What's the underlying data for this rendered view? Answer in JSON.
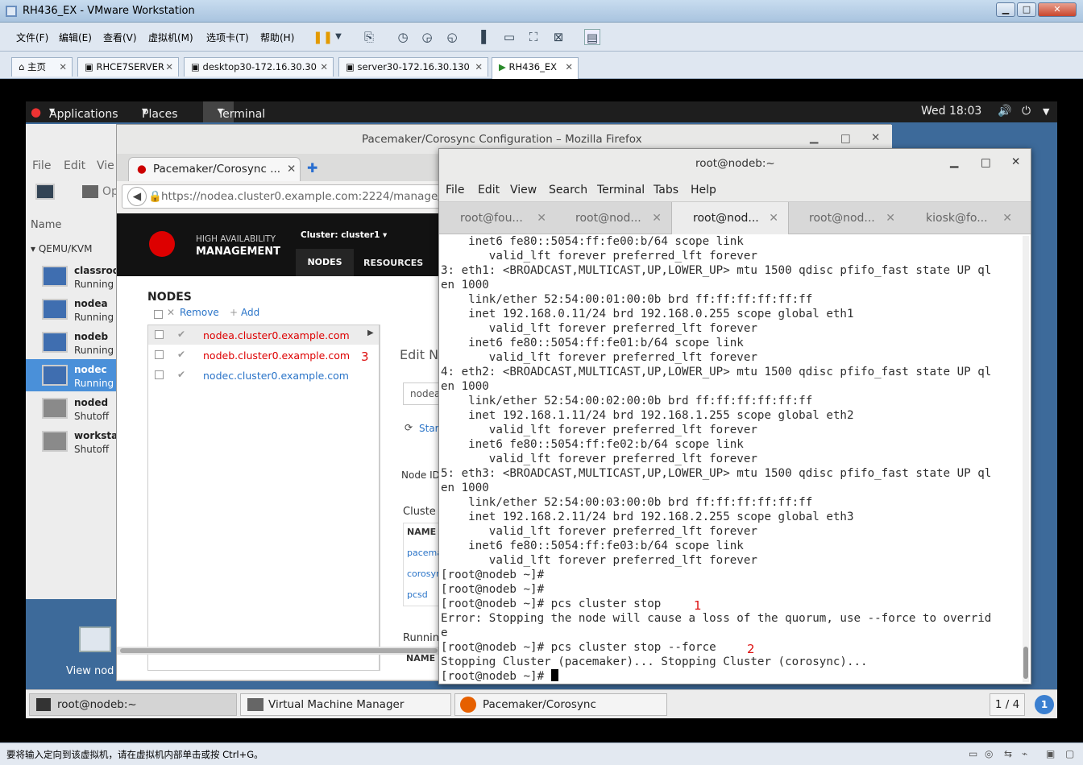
{
  "vmware": {
    "title": "RH436_EX - VMware Workstation",
    "menu": [
      "文件(F)",
      "编辑(E)",
      "查看(V)",
      "虚拟机(M)",
      "选项卡(T)",
      "帮助(H)"
    ],
    "tabs": [
      "主页",
      "RHCE7SERVER",
      "desktop30-172.16.30.30",
      "server30-172.16.30.130",
      "RH436_EX"
    ],
    "status": "要将输入定向到该虚拟机，请在虚拟机内部单击或按 Ctrl+G。"
  },
  "gnome": {
    "applications": "Applications",
    "places": "Places",
    "terminal": "Terminal",
    "clock": "Wed 18:03",
    "desktop_icon_label": "View nod"
  },
  "virt_manager": {
    "menu": [
      "File",
      "Edit",
      "Vie"
    ],
    "open_partial": "Op",
    "column": "Name",
    "group": "QEMU/KVM",
    "vms": [
      {
        "name": "classroo",
        "state": "Running"
      },
      {
        "name": "nodea",
        "state": "Running"
      },
      {
        "name": "nodeb",
        "state": "Running"
      },
      {
        "name": "nodec",
        "state": "Running"
      },
      {
        "name": "noded",
        "state": "Shutoff"
      },
      {
        "name": "workstat",
        "state": "Shutoff"
      }
    ]
  },
  "firefox": {
    "title": "Pacemaker/Corosync Configuration – Mozilla Firefox",
    "tab": "Pacemaker/Corosync ...",
    "url": "https://nodea.cluster0.example.com:2224/manage/",
    "brand1": "HIGH AVAILABILITY",
    "brand2": "MANAGEMENT",
    "cluster": "Cluster: cluster1 ▾",
    "nav": [
      "NODES",
      "RESOURCES"
    ],
    "nodes_heading": "NODES",
    "remove": "Remove",
    "add": "Add",
    "nodes": [
      "nodea.cluster0.example.com",
      "nodeb.cluster0.example.com",
      "nodec.cluster0.example.com"
    ],
    "edit_partial": "Edit N",
    "node_input_partial": "nodea",
    "start_partial": "Star",
    "node_id_partial": "Node ID",
    "cluster_partial": "Cluste",
    "name_col": "NAME",
    "services": [
      "pacema",
      "corosyn",
      "pcsd"
    ],
    "running_partial": "Runnin",
    "name_col2": "NAME"
  },
  "terminal": {
    "title": "root@nodeb:~",
    "menu": [
      "File",
      "Edit",
      "View",
      "Search",
      "Terminal",
      "Tabs",
      "Help"
    ],
    "tabs": [
      "root@fou...",
      "root@nod...",
      "root@nod...",
      "root@nod...",
      "kiosk@fo..."
    ],
    "lines": [
      "    inet6 fe80::5054:ff:fe00:b/64 scope link",
      "       valid_lft forever preferred_lft forever",
      "3: eth1: <BROADCAST,MULTICAST,UP,LOWER_UP> mtu 1500 qdisc pfifo_fast state UP ql",
      "en 1000",
      "    link/ether 52:54:00:01:00:0b brd ff:ff:ff:ff:ff:ff",
      "    inet 192.168.0.11/24 brd 192.168.0.255 scope global eth1",
      "       valid_lft forever preferred_lft forever",
      "    inet6 fe80::5054:ff:fe01:b/64 scope link",
      "       valid_lft forever preferred_lft forever",
      "4: eth2: <BROADCAST,MULTICAST,UP,LOWER_UP> mtu 1500 qdisc pfifo_fast state UP ql",
      "en 1000",
      "    link/ether 52:54:00:02:00:0b brd ff:ff:ff:ff:ff:ff",
      "    inet 192.168.1.11/24 brd 192.168.1.255 scope global eth2",
      "       valid_lft forever preferred_lft forever",
      "    inet6 fe80::5054:ff:fe02:b/64 scope link",
      "       valid_lft forever preferred_lft forever",
      "5: eth3: <BROADCAST,MULTICAST,UP,LOWER_UP> mtu 1500 qdisc pfifo_fast state UP ql",
      "en 1000",
      "    link/ether 52:54:00:03:00:0b brd ff:ff:ff:ff:ff:ff",
      "    inet 192.168.2.11/24 brd 192.168.2.255 scope global eth3",
      "       valid_lft forever preferred_lft forever",
      "    inet6 fe80::5054:ff:fe03:b/64 scope link",
      "       valid_lft forever preferred_lft forever",
      "[root@nodeb ~]#",
      "[root@nodeb ~]#",
      "[root@nodeb ~]# pcs cluster stop",
      "Error: Stopping the node will cause a loss of the quorum, use --force to overrid",
      "e",
      "[root@nodeb ~]# pcs cluster stop --force",
      "Stopping Cluster (pacemaker)... Stopping Cluster (corosync)...",
      "[root@nodeb ~]# "
    ]
  },
  "annotations": [
    "1",
    "2",
    "3"
  ],
  "taskbar": {
    "items": [
      "root@nodeb:~",
      "Virtual Machine Manager",
      "Pacemaker/Corosync Configuratio..."
    ],
    "workspace": "1 / 4",
    "info": "1"
  }
}
